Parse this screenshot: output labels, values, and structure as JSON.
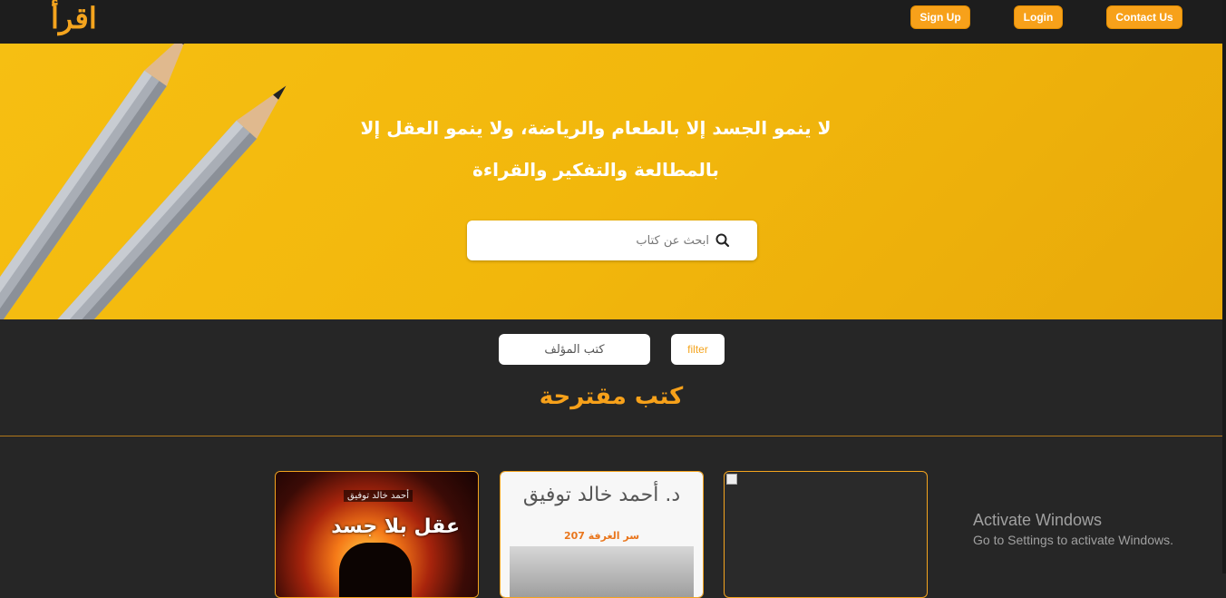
{
  "navbar": {
    "logo": "اقرأ",
    "buttons": {
      "signup": "Sign Up",
      "login": "Login",
      "contact": "Contact Us"
    }
  },
  "hero": {
    "quote_line1": "لا ينمو الجسد إلا بالطعام والرياضة، ولا ينمو العقل إلا",
    "quote_line2": "بالمطالعة والتفكير والقراءة",
    "search": {
      "placeholder": "ابحث عن كتاب"
    }
  },
  "filter": {
    "select_value": "كتب المؤلف",
    "button_label": "filter"
  },
  "section": {
    "title": "كتب مقترحة"
  },
  "books": [
    {
      "title": "عقل بلا جسد",
      "author": "أحمد خالد توفيق"
    },
    {
      "author": "د. أحمد خالد توفيق",
      "subtitle": "سر الغرفة 207"
    },
    {
      "title": ""
    }
  ],
  "watermark": {
    "title": "Activate Windows",
    "subtitle": "Go to Settings to activate Windows."
  },
  "colors": {
    "accent": "#f7a11a",
    "hero": "#f2b70c",
    "background": "#262626"
  }
}
